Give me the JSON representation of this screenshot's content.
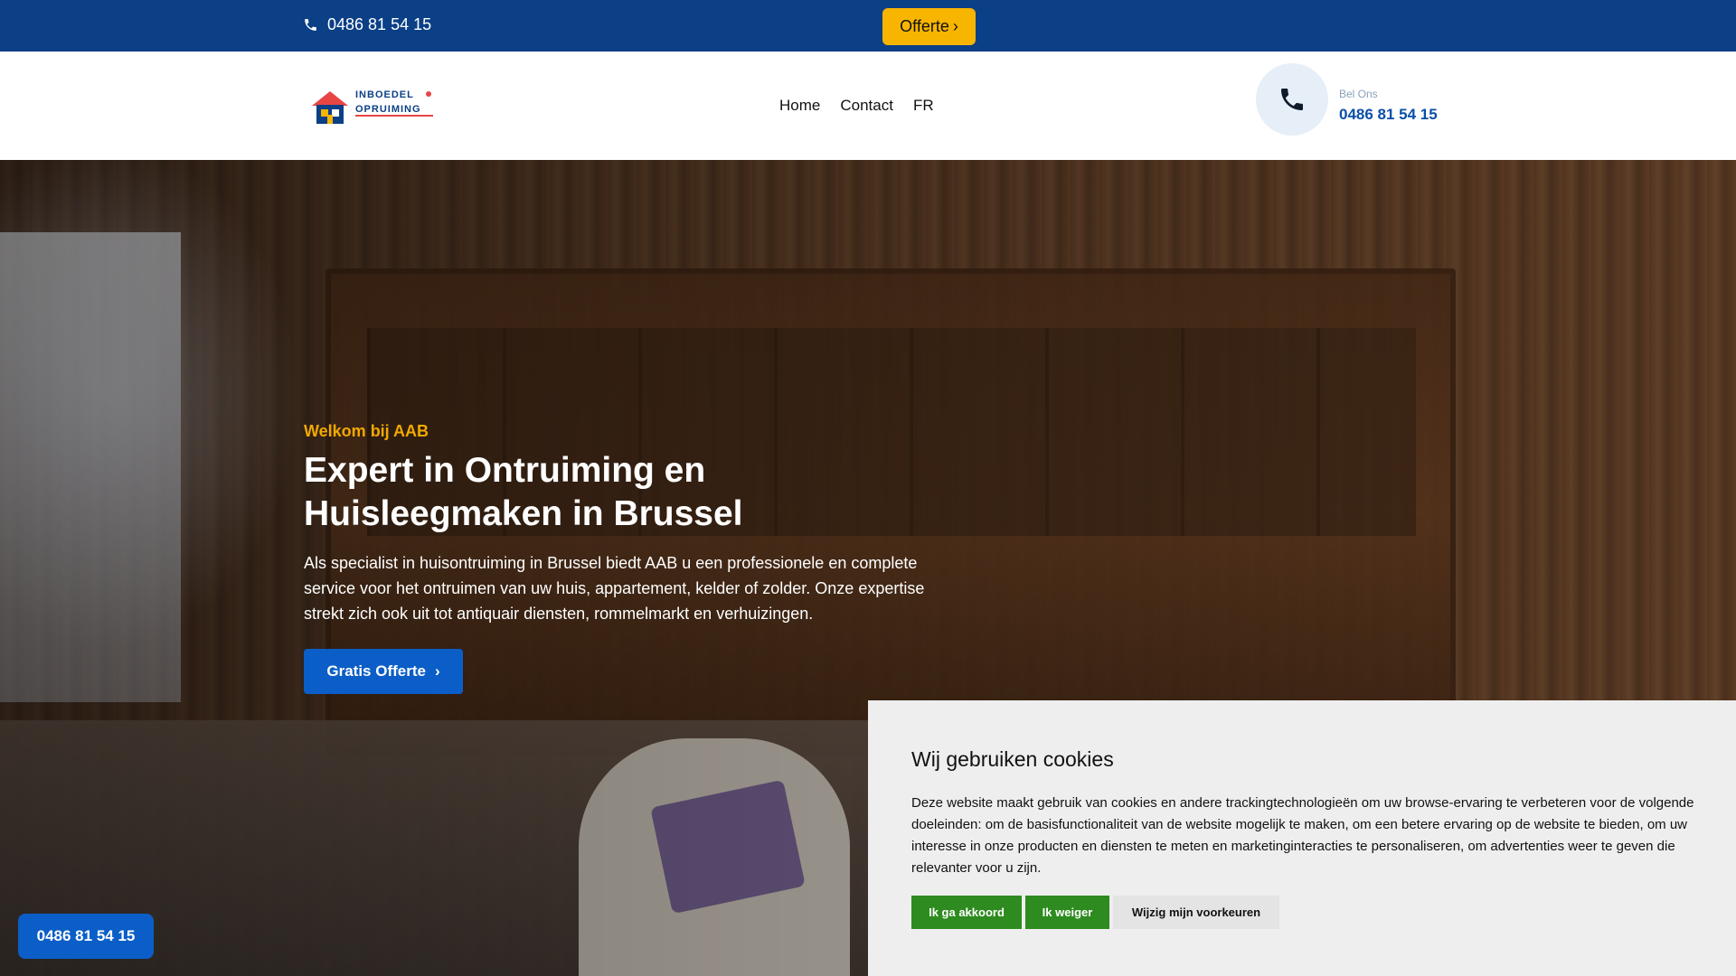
{
  "topbar": {
    "phone": "0486 81 54 15",
    "offerte_label": "Offerte",
    "bg_color": "#0b3f86",
    "accent_color": "#f7b500"
  },
  "header": {
    "logo": {
      "line1": "INBOEDEL",
      "line2": "OPRUIMING"
    },
    "nav": [
      "Home",
      "Contact",
      "FR"
    ],
    "call_label": "Bel Ons",
    "call_number": "0486 81 54 15"
  },
  "hero": {
    "welcome": "Welkom bij AAB",
    "title": "Expert in Ontruiming en Huisleegmaken in Brussel",
    "text": "Als specialist in huisontruiming in Brussel biedt AAB u een professionele en complete service voor het ontruimen van uw huis, appartement, kelder of zolder. Onze expertise strekt zich ook uit tot antiquair diensten, rommelmarkt en verhuizingen.",
    "cta_label": "Gratis Offerte"
  },
  "float_phone": "0486 81 54 15",
  "cookie": {
    "title": "Wij gebruiken cookies",
    "text": "Deze website maakt gebruik van cookies en andere trackingtechnologieën om uw browse-ervaring te verbeteren voor de volgende doeleinden: om de basisfunctionaliteit van de website mogelijk te maken, om een betere ervaring op de website te bieden, om uw interesse in onze producten en diensten te meten en marketinginteracties te personaliseren, om advertenties weer te geven die relevanter voor u zijn.",
    "accept_label": "Ik ga akkoord",
    "decline_label": "Ik weiger",
    "prefs_label": "Wijzig mijn voorkeuren",
    "button_color": "#2e8b1f"
  }
}
